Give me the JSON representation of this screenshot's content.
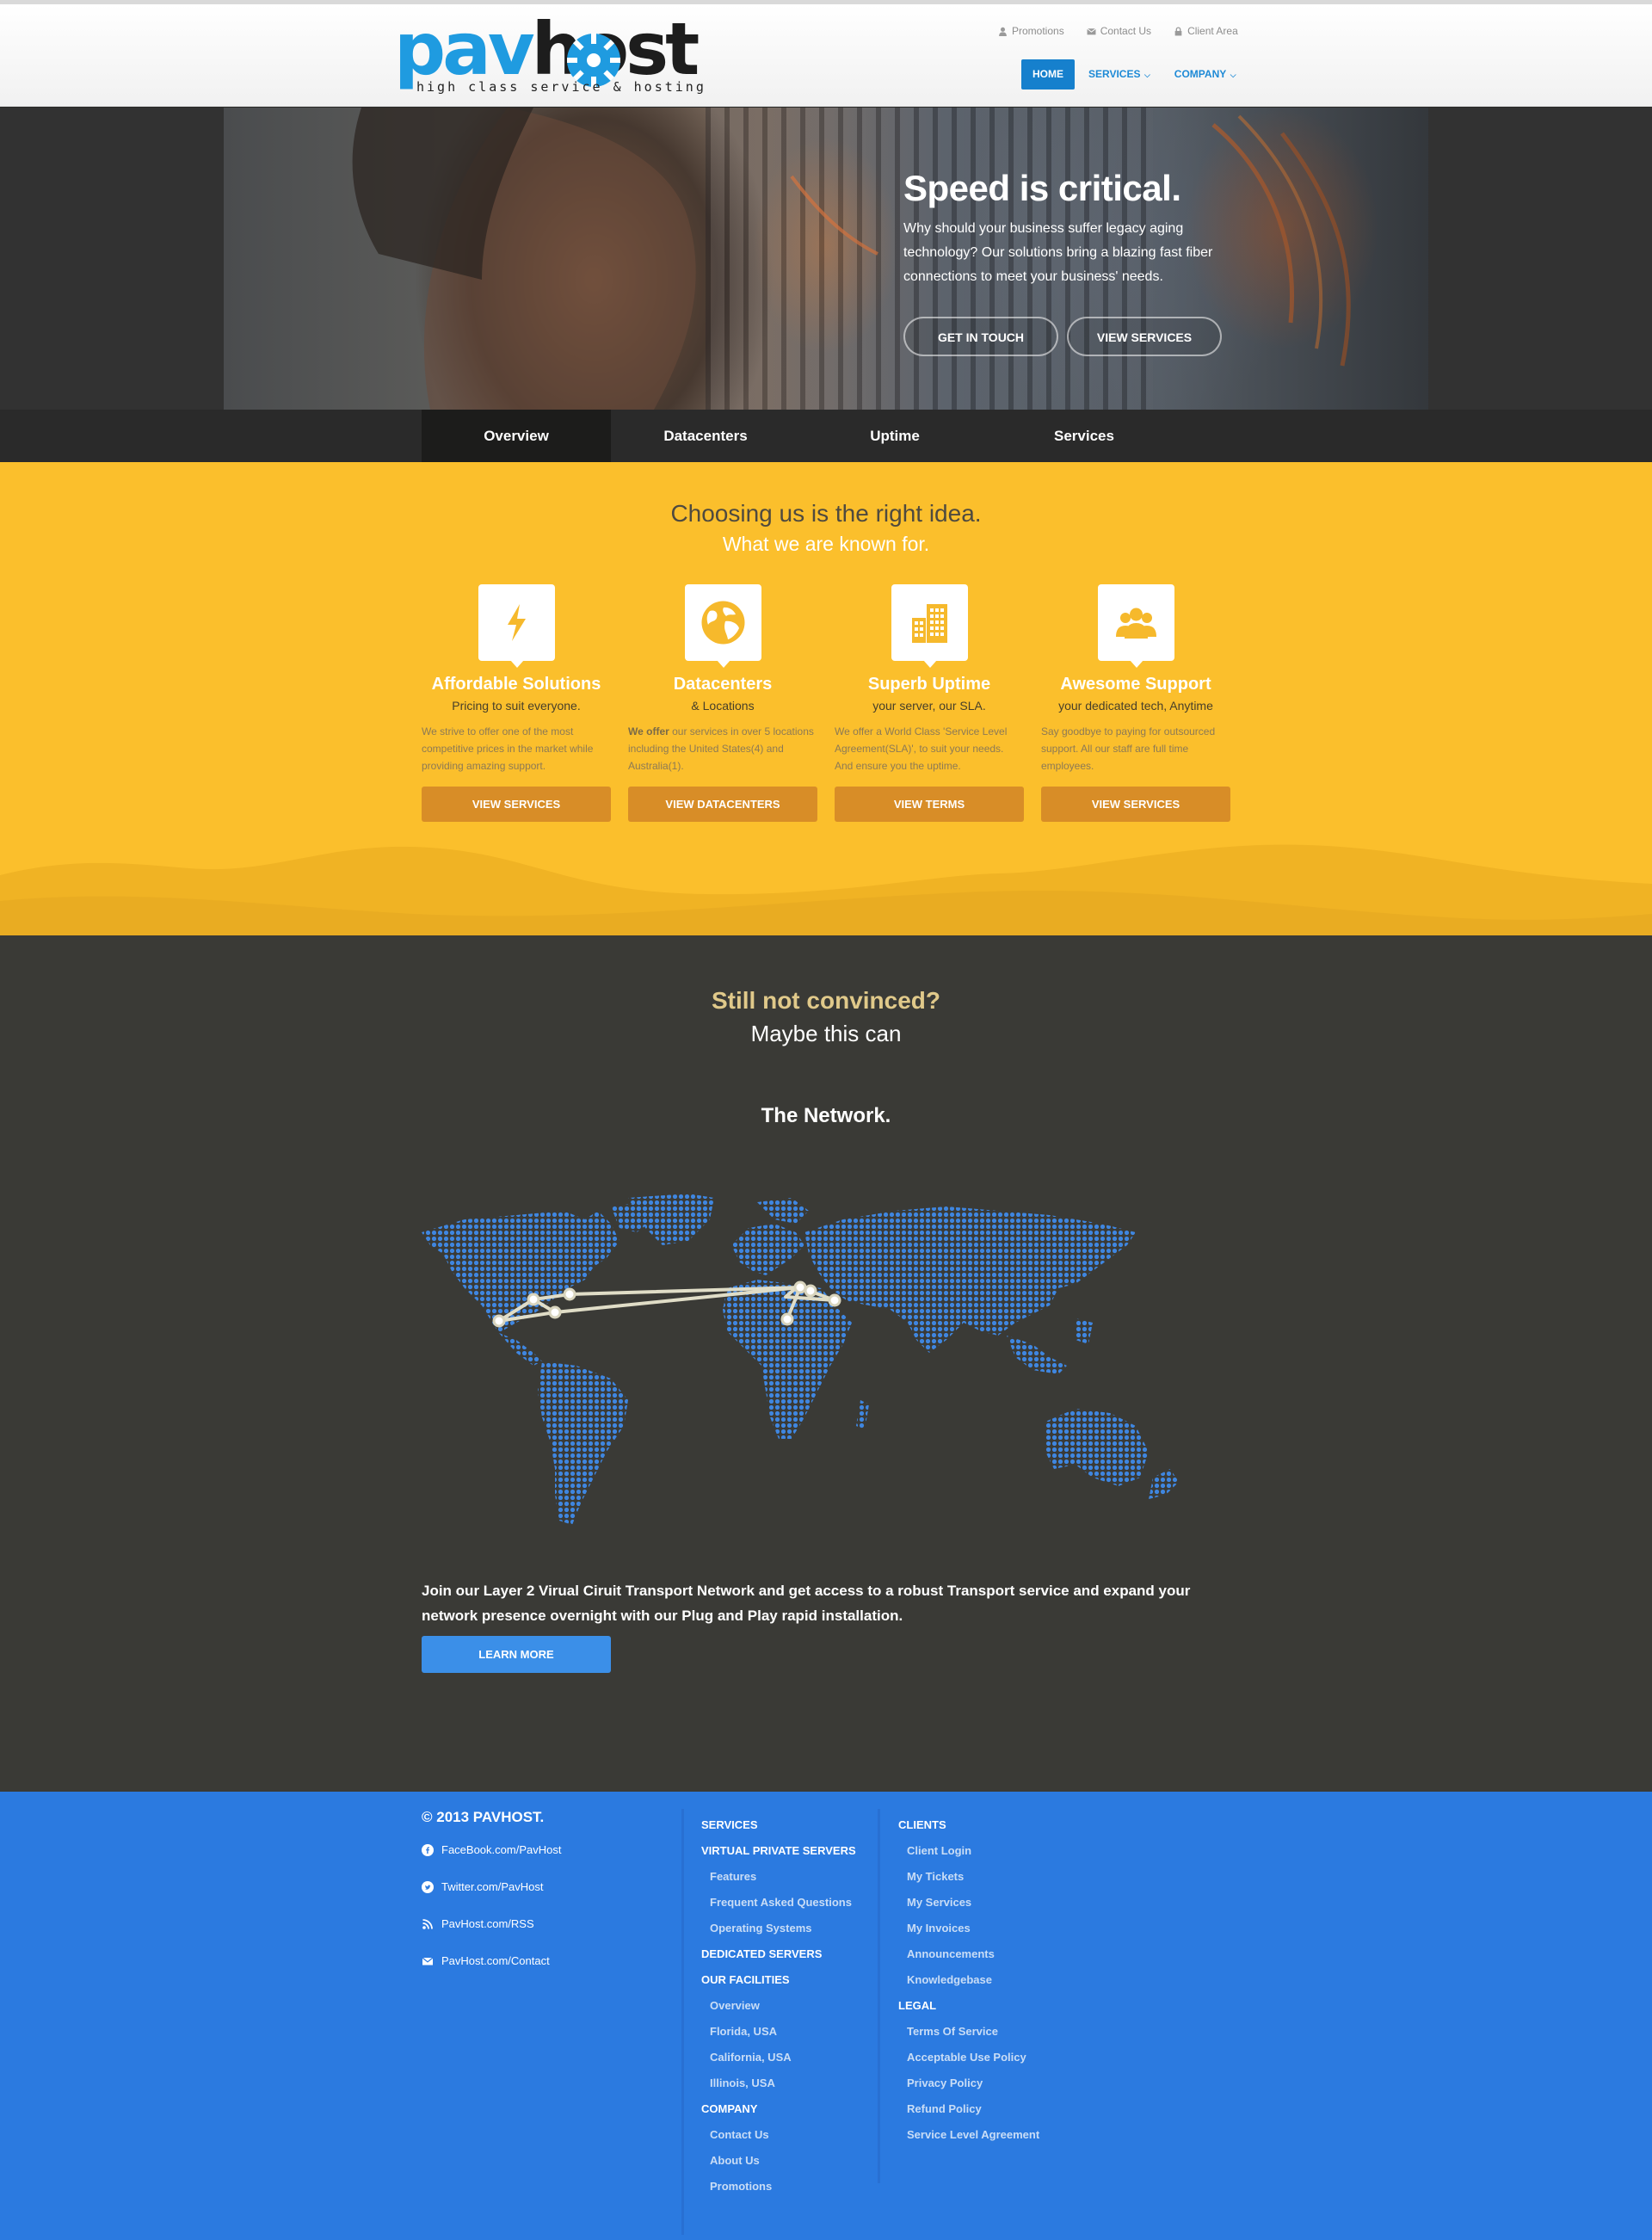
{
  "header": {
    "logo": {
      "part1": "pav",
      "part2": "host",
      "tagline": "high class service & hosting"
    },
    "utility": [
      {
        "icon": "user-icon",
        "label": "Promotions"
      },
      {
        "icon": "envelope-icon",
        "label": "Contact Us"
      },
      {
        "icon": "lock-icon",
        "label": "Client Area"
      }
    ],
    "nav": [
      {
        "label": "HOME",
        "active": true
      },
      {
        "label": "SERVICES",
        "dropdown": true
      },
      {
        "label": "COMPANY",
        "dropdown": true
      }
    ]
  },
  "hero": {
    "title": "Speed is critical.",
    "text": "Why should your business suffer legacy aging technology? Our solutions bring a blazing fast fiber connections to meet your business' needs.",
    "buttons": [
      "GET IN TOUCH",
      "VIEW SERVICES"
    ]
  },
  "tabs": [
    {
      "label": "Overview",
      "active": true
    },
    {
      "label": "Datacenters"
    },
    {
      "label": "Uptime"
    },
    {
      "label": "Services"
    }
  ],
  "features": {
    "heading": "Choosing us is the right idea.",
    "subheading": "What we are known for.",
    "items": [
      {
        "icon": "lightning-icon",
        "title": "Affordable Solutions",
        "subtitle": "Pricing to suit everyone.",
        "desc": "We strive to offer one of the most competitive prices in the market while providing amazing support.",
        "button": "VIEW SERVICES"
      },
      {
        "icon": "globe-icon",
        "title": "Datacenters",
        "subtitle": "& Locations",
        "desc_bold": "We offer",
        "desc": " our services in over 5 locations including the United States(4) and Australia(1).",
        "button": "VIEW DATACENTERS"
      },
      {
        "icon": "building-icon",
        "title": "Superb Uptime",
        "subtitle": "your server, our SLA.",
        "desc": "We offer a World Class 'Service Level Agreement(SLA)', to suit your needs. And ensure you the uptime.",
        "button": "VIEW TERMS"
      },
      {
        "icon": "users-icon",
        "title": "Awesome Support",
        "subtitle": "your dedicated tech, Anytime",
        "desc": "Say goodbye to paying for outsourced support. All our staff are full time employees.",
        "button": "VIEW SERVICES"
      }
    ]
  },
  "network": {
    "heading": "Still not convinced?",
    "subheading": "Maybe this can",
    "title": "The Network.",
    "text": "Join our Layer 2 Virual Ciruit Transport Network and get access to a robust Transport service and expand your network presence overnight with our Plug and Play rapid installation.",
    "button": "LEARN MORE"
  },
  "footer": {
    "copyright": "© 2013 PAVHOST.",
    "social": [
      {
        "icon": "facebook-icon",
        "label": "FaceBook.com/PavHost"
      },
      {
        "icon": "twitter-icon",
        "label": "Twitter.com/PavHost"
      },
      {
        "icon": "rss-icon",
        "label": "PavHost.com/RSS"
      },
      {
        "icon": "envelope-icon",
        "label": "PavHost.com/Contact"
      }
    ],
    "col1": [
      {
        "label": "SERVICES",
        "type": "head"
      },
      {
        "label": "VIRTUAL PRIVATE SERVERS",
        "type": "head"
      },
      {
        "label": "Features",
        "type": "sub"
      },
      {
        "label": "Frequent Asked Questions",
        "type": "sub"
      },
      {
        "label": "Operating Systems",
        "type": "sub"
      },
      {
        "label": "DEDICATED SERVERS",
        "type": "head"
      },
      {
        "label": "OUR FACILITIES",
        "type": "head"
      },
      {
        "label": "Overview",
        "type": "sub"
      },
      {
        "label": "Florida, USA",
        "type": "sub"
      },
      {
        "label": "California, USA",
        "type": "sub"
      },
      {
        "label": "Illinois, USA",
        "type": "sub"
      },
      {
        "label": "COMPANY",
        "type": "head"
      },
      {
        "label": "Contact Us",
        "type": "sub"
      },
      {
        "label": "About Us",
        "type": "sub"
      },
      {
        "label": "Promotions",
        "type": "sub"
      }
    ],
    "col2": [
      {
        "label": "CLIENTS",
        "type": "head"
      },
      {
        "label": "Client Login",
        "type": "sub"
      },
      {
        "label": "My Tickets",
        "type": "sub"
      },
      {
        "label": "My Services",
        "type": "sub"
      },
      {
        "label": "My Invoices",
        "type": "sub"
      },
      {
        "label": "Announcements",
        "type": "sub"
      },
      {
        "label": "Knowledgebase",
        "type": "sub"
      },
      {
        "label": "LEGAL",
        "type": "head"
      },
      {
        "label": "Terms Of Service",
        "type": "sub"
      },
      {
        "label": "Acceptable Use Policy",
        "type": "sub"
      },
      {
        "label": "Privacy Policy",
        "type": "sub"
      },
      {
        "label": "Refund Policy",
        "type": "sub"
      },
      {
        "label": "Service Level Agreement",
        "type": "sub"
      }
    ]
  },
  "colors": {
    "brand_blue": "#1f9be0",
    "nav_active": "#1680cd",
    "yellow": "#fbbf2c",
    "orange_button": "#d88d27",
    "dark_bg": "#3a3a36",
    "footer_blue": "#2b7ae0",
    "map_dot": "#3f86e0"
  }
}
